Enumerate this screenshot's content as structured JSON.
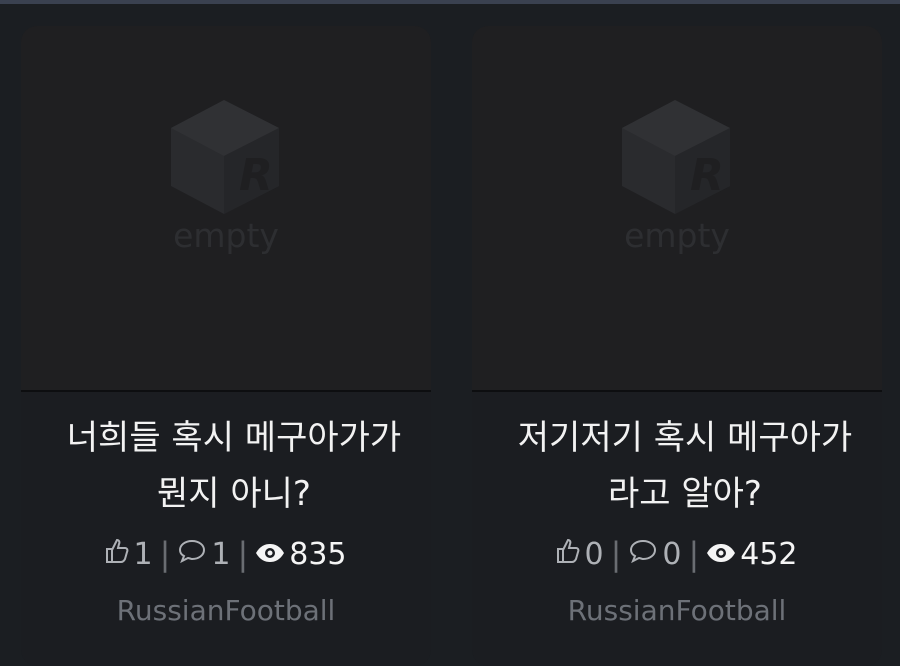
{
  "cards": [
    {
      "thumb_label": "empty",
      "title_line1": "너희들 혹시 메구아가가",
      "title_line2": "뭔지 아니?",
      "likes": "1",
      "comments": "1",
      "views": "835",
      "author": "RussianFootball"
    },
    {
      "thumb_label": "empty",
      "title_line1": "저기저기 혹시 메구아가",
      "title_line2": "라고 알아?",
      "likes": "0",
      "comments": "0",
      "views": "452",
      "author": "RussianFootball"
    }
  ],
  "icons": {
    "like": "thumbs-up-icon",
    "comment": "comment-icon",
    "views": "eye-icon",
    "placeholder": "empty-logo-icon"
  },
  "colors": {
    "background": "#1b1e22",
    "card": "#1b1d21",
    "title": "#f2f2f2",
    "stat": "#aeb1b6",
    "author": "#6d7178"
  }
}
